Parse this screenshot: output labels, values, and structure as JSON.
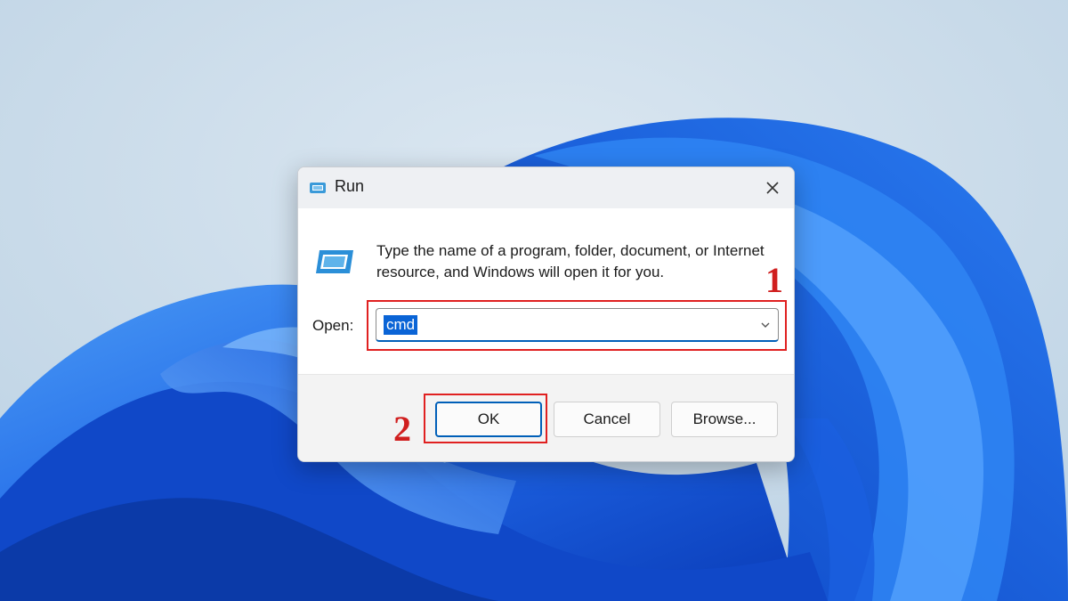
{
  "dialog": {
    "title": "Run",
    "title_icon": "run-icon",
    "close_icon": "close-icon",
    "description": "Type the name of a program, folder, document, or Internet resource, and Windows will open it for you.",
    "open_label": "Open:",
    "open_value": "cmd",
    "dropdown_icon": "chevron-down-icon",
    "buttons": {
      "ok": "OK",
      "cancel": "Cancel",
      "browse": "Browse..."
    }
  },
  "annotations": {
    "step1": "1",
    "step2": "2",
    "color": "#d01f1f"
  },
  "colors": {
    "accent": "#005fb8",
    "selection": "#0a64d6",
    "wallpaper_bg": "#c5d8e8",
    "wallpaper_bloom": "#1a5fe0"
  }
}
